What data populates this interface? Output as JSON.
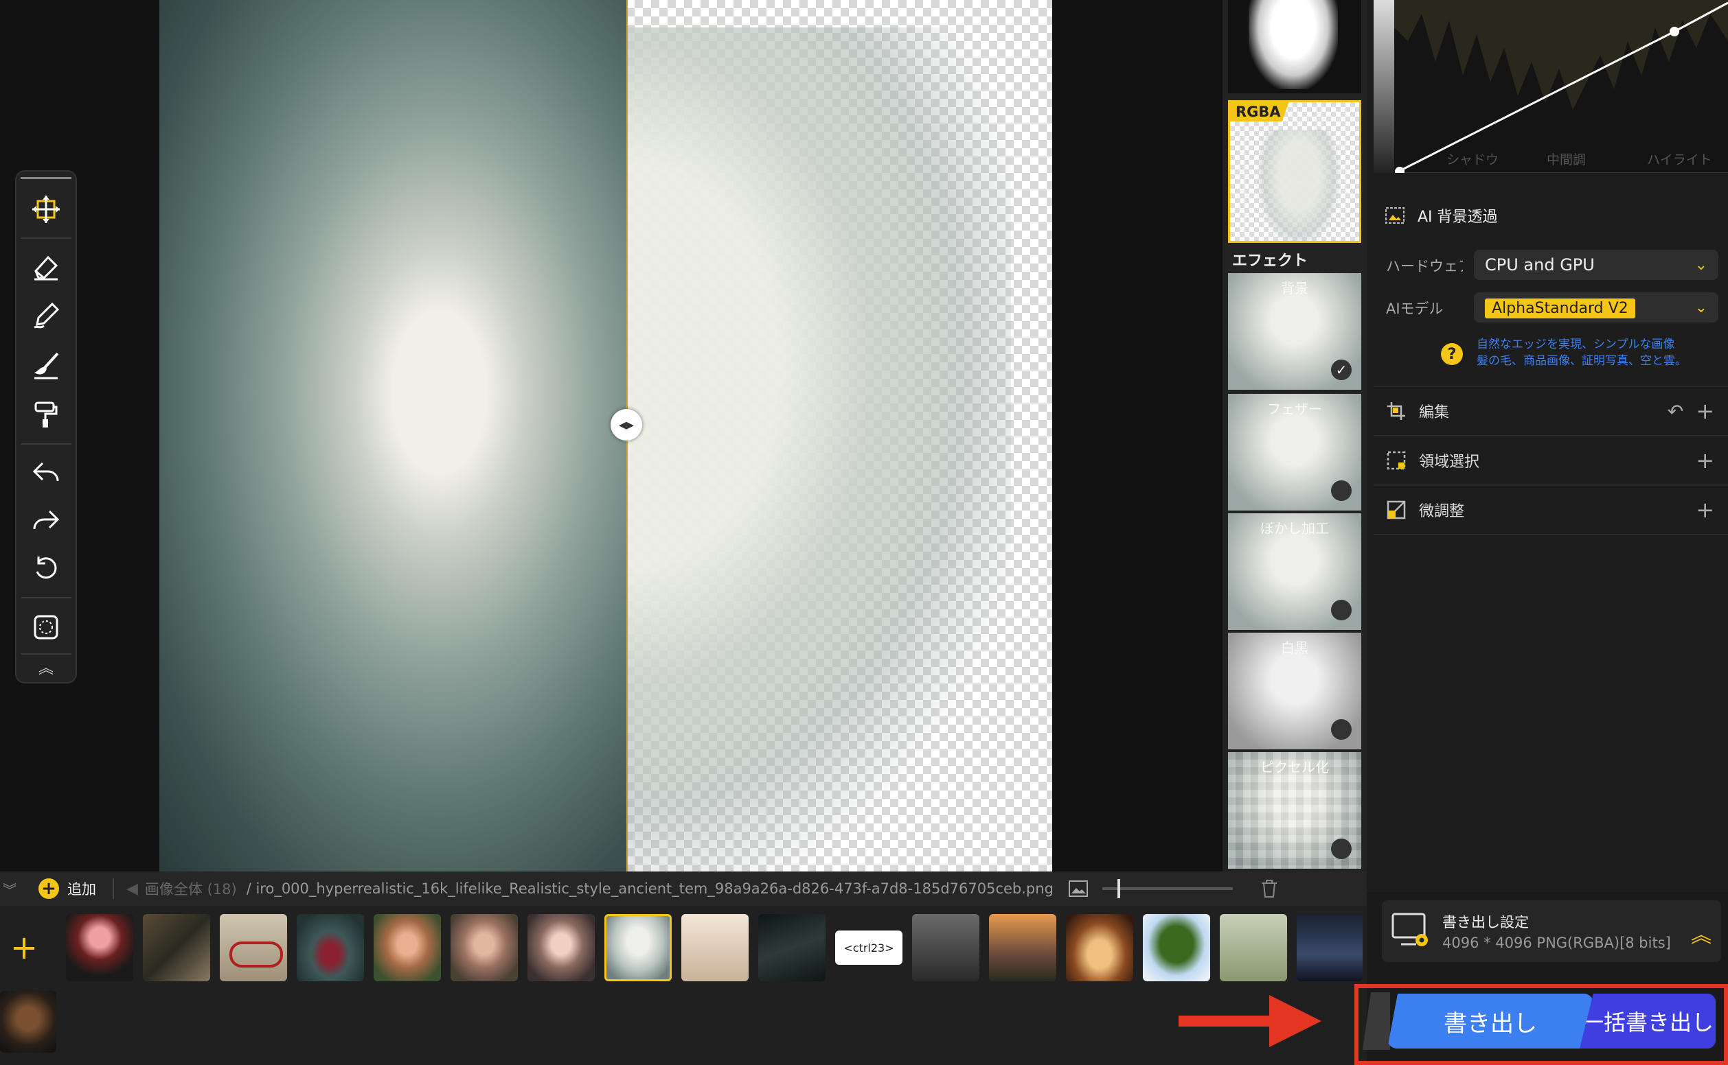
{
  "colors": {
    "accent": "#f5c518",
    "export_blue": "#3c7ff0",
    "batch_blue": "#3f3fe0",
    "arrow_red": "#e53523",
    "compare_line": "#c8a92f"
  },
  "thumbnails_column": {
    "rgba_label": "RGBA",
    "effects_label": "エフェクト",
    "effects": [
      {
        "label": "背景",
        "selected": true
      },
      {
        "label": "フェザー",
        "selected": false
      },
      {
        "label": "ぼかし加工",
        "selected": false
      },
      {
        "label": "白黒",
        "selected": false
      },
      {
        "label": "ピクセル化",
        "selected": false
      }
    ]
  },
  "curve": {
    "labels": [
      "シャドウ",
      "中間調",
      "ハイライト"
    ]
  },
  "panel": {
    "ai_bg": {
      "title": "AI 背景透過",
      "hardware_label": "ハードウェア",
      "hardware_value": "CPU and GPU",
      "model_label": "AIモデル",
      "model_value": "AlphaStandard  V2",
      "hint_line1": "自然なエッジを実現、シンプルな画像",
      "hint_line2": "髪の毛、商品画像、証明写真、空と雲。"
    },
    "sections": [
      {
        "icon": "crop-icon",
        "label": "編集"
      },
      {
        "icon": "selection-icon",
        "label": "領域選択"
      },
      {
        "icon": "adjust-icon",
        "label": "微調整"
      }
    ]
  },
  "bottombar": {
    "add_label": "追加",
    "count_label": "画像全体 (18)",
    "path": "/ iro_000_hyperrealistic_16k_lifelike_Realistic_style_ancient_tem_98a9a26a-d826-473f-a7d8-185d76705ceb.png"
  },
  "filmstrip": {
    "ctrl_thumb_label": "<ctrl23>",
    "count": 17
  },
  "export": {
    "settings_title": "書き出し設定",
    "settings_value": "4096 * 4096 PNG(RGBA)[8 bits]",
    "export_label": "書き出し",
    "batch_label": "一括書き出し"
  }
}
